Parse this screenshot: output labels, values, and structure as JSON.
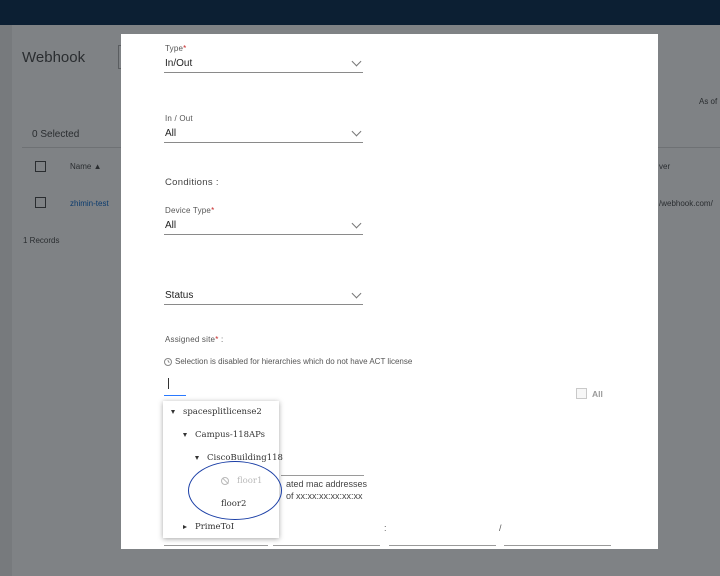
{
  "background": {
    "page_title": "Webhook",
    "as_of": "As of",
    "selected": "0 Selected",
    "col_name": "Name ▲",
    "col_server": "ver",
    "row_name": "zhimin-test",
    "row_url": "/webhook.com/",
    "records": "1 Records"
  },
  "form": {
    "type_label": "Type",
    "type_value": "In/Out",
    "inout_label": "In / Out",
    "inout_value": "All",
    "conditions": "Conditions :",
    "device_type_label": "Device Type",
    "device_type_value": "All",
    "status_label": "Status",
    "assigned_site_label": "Assigned site",
    "assigned_site_suffix": " :",
    "required_mark": "*",
    "info_text": "Selection is disabled for hierarchies which do not have ACT license",
    "all_label": "All",
    "partial_mac_1": "ated mac addresses",
    "partial_mac_2": "of xx:xx:xx:xx:xx:xx",
    "colon_1": ":",
    "colon_2": "/"
  },
  "tree": [
    {
      "label": "spacesplitlicense2",
      "state": "expanded"
    },
    {
      "label": "Campus-118APs",
      "state": "expanded"
    },
    {
      "label": "CiscoBuilding118",
      "state": "expanded"
    },
    {
      "label": "floor1",
      "state": "disabled"
    },
    {
      "label": "floor2",
      "state": "leaf"
    },
    {
      "label": "PrimeToI",
      "state": "collapsed"
    }
  ],
  "colors": {
    "topbar": "#0c1f33",
    "required": "#c62828",
    "highlight_ellipse": "#1b3fa6",
    "focus_underline": "#2979ff"
  }
}
